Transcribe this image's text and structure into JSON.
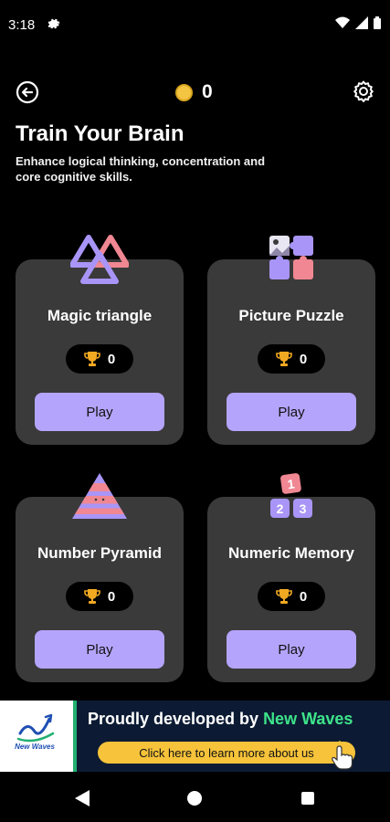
{
  "status_bar": {
    "time": "3:18"
  },
  "header": {
    "coins": "0"
  },
  "intro": {
    "title": "Train Your Brain",
    "subtitle": "Enhance logical thinking, concentration and core cognitive skills."
  },
  "games": [
    {
      "title": "Magic triangle",
      "score": "0",
      "play_label": "Play",
      "icon": "triangle-icon"
    },
    {
      "title": "Picture Puzzle",
      "score": "0",
      "play_label": "Play",
      "icon": "puzzle-icon"
    },
    {
      "title": "Number Pyramid",
      "score": "0",
      "play_label": "Play",
      "icon": "pyramid-icon"
    },
    {
      "title": "Numeric Memory",
      "score": "0",
      "play_label": "Play",
      "icon": "number-blocks-icon",
      "digits": [
        "1",
        "2",
        "3"
      ]
    }
  ],
  "banner": {
    "headline": "Proudly developed by",
    "brand": "New Waves",
    "cta": "Click here to learn more about us"
  },
  "colors": {
    "card_bg": "#3a3a3a",
    "play_button": "#b5a4fb",
    "accent_purple": "#a995f7",
    "accent_pink": "#f08792",
    "coin": "#f4c542",
    "trophy": "#f2a922",
    "banner_bg": "#0c1b33",
    "brand_green": "#3ee38a",
    "cta_yellow": "#f6c33a"
  }
}
